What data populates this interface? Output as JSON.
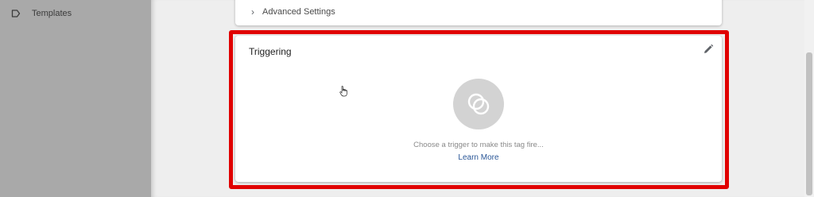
{
  "sidebar": {
    "items": [
      {
        "label": "Templates",
        "icon": "tag-icon"
      }
    ]
  },
  "advanced_settings": {
    "label": "Advanced Settings",
    "icon": "chevron-right-icon"
  },
  "triggering": {
    "title": "Triggering",
    "edit_icon": "pencil-icon",
    "trigger_icon": "trigger-circles-icon",
    "hint": "Choose a trigger to make this tag fire...",
    "learn_more": "Learn More"
  },
  "colors": {
    "highlight": "#e00000",
    "link": "#2b5797",
    "sidebar_bg": "#a9a9a9",
    "trigger_circle": "#d3d3d3"
  }
}
